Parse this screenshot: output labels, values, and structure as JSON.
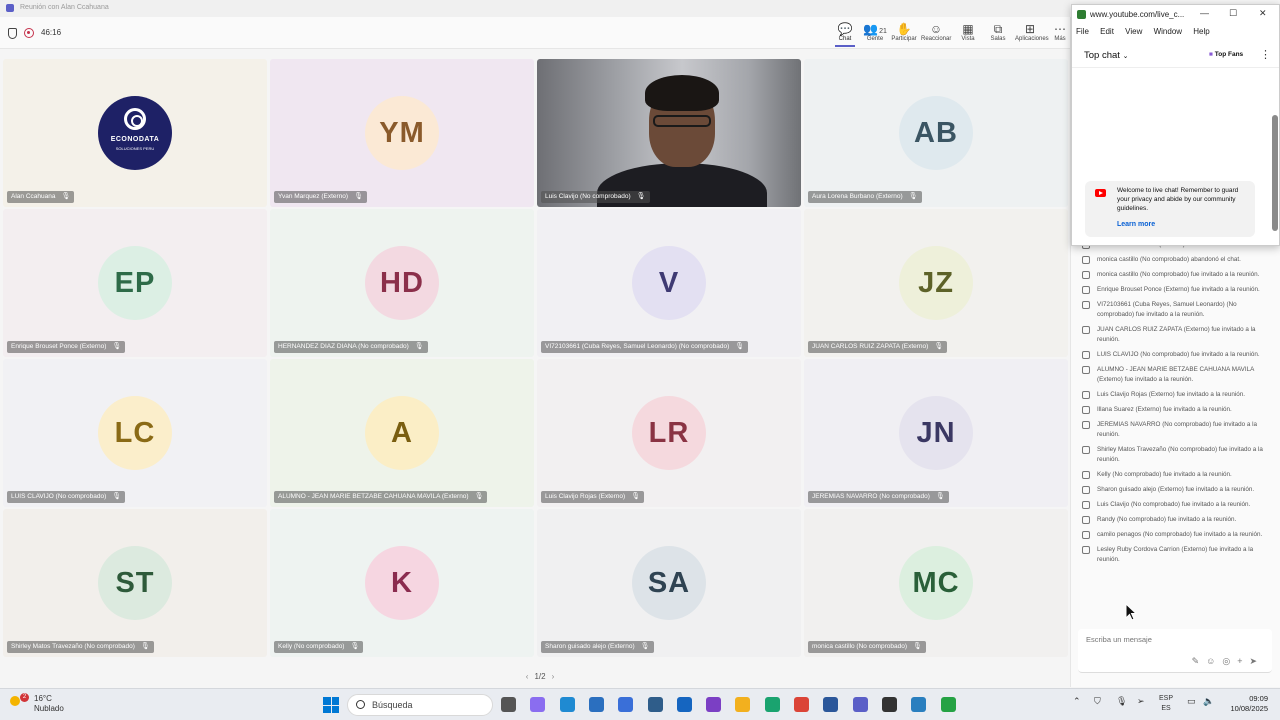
{
  "window": {
    "title": "Reunión con Alan Ccahuana"
  },
  "meeting": {
    "timer": "46:16",
    "toolbar": [
      {
        "label": "Chat",
        "icon": "chat-icon",
        "glyph": "💬",
        "active": true
      },
      {
        "label": "Gente",
        "icon": "people-icon",
        "glyph": "👥",
        "count": "21"
      },
      {
        "label": "Participar",
        "icon": "hand-icon",
        "glyph": "✋"
      },
      {
        "label": "Reaccionar",
        "icon": "emoji-icon",
        "glyph": "☺"
      },
      {
        "label": "Vista",
        "icon": "grid-view-icon",
        "glyph": "▦"
      },
      {
        "label": "Salas",
        "icon": "rooms-icon",
        "glyph": "⧉"
      },
      {
        "label": "Aplicaciones",
        "icon": "add-apps-icon",
        "glyph": "⊞"
      },
      {
        "label": "Más",
        "icon": "more-icon",
        "glyph": "⋯"
      }
    ]
  },
  "participants": [
    {
      "initials": "",
      "name": "Alan Ccahuana",
      "type": "logo",
      "bg": "#f4f1e9",
      "avatar_bg": "#1e2166",
      "avatar_fg": "#ffffff",
      "logo_line1": "ECONODATA",
      "logo_line2": "SOLUCIONES PERU"
    },
    {
      "initials": "YM",
      "name": "Yvan Marquez (Externo)",
      "bg": "#f0e7f1",
      "avatar_bg": "#fbe9d5",
      "avatar_fg": "#8a5a2b"
    },
    {
      "initials": "",
      "name": "Luis Clavijo (No comprobado)",
      "type": "video",
      "bg": "#8d8f94"
    },
    {
      "initials": "AB",
      "name": "Aura Lorena Burbano (Externo)",
      "bg": "#eef1f2",
      "avatar_bg": "#dfe9ee",
      "avatar_fg": "#3b5563"
    },
    {
      "initials": "EP",
      "name": "Enrique Brouset Ponce (Externo)",
      "bg": "#f3eef0",
      "avatar_bg": "#dcefe4",
      "avatar_fg": "#2e6b48"
    },
    {
      "initials": "HD",
      "name": "HERNANDEZ DIAZ DIANA (No comprobado)",
      "bg": "#eef3ef",
      "avatar_bg": "#f3d9e1",
      "avatar_fg": "#8b2f4a"
    },
    {
      "initials": "V",
      "name": "VI72103661 (Cuba Reyes, Samuel Leonardo) (No comprobado)",
      "bg": "#f1f0f3",
      "avatar_bg": "#e3e0f2",
      "avatar_fg": "#3f3a73"
    },
    {
      "initials": "JZ",
      "name": "JUAN CARLOS RUIZ ZAPATA (Externo)",
      "bg": "#f2f1ee",
      "avatar_bg": "#eef0da",
      "avatar_fg": "#5d6228"
    },
    {
      "initials": "LC",
      "name": "LUIS CLAVIJO (No comprobado)",
      "bg": "#f1f1f4",
      "avatar_bg": "#fbeecb",
      "avatar_fg": "#8a6a16"
    },
    {
      "initials": "A",
      "name": "ALUMNO - JEAN MARIE BETZABE CAHUANA MAVILA (Externo)",
      "bg": "#eef3ea",
      "avatar_bg": "#fbeec6",
      "avatar_fg": "#7a5e10"
    },
    {
      "initials": "LR",
      "name": "Luis Clavijo Rojas (Externo)",
      "bg": "#f2f0f1",
      "avatar_bg": "#f5d9de",
      "avatar_fg": "#8a3343"
    },
    {
      "initials": "JN",
      "name": "JEREMIAS NAVARRO (No comprobado)",
      "bg": "#f0eff3",
      "avatar_bg": "#e5e3ee",
      "avatar_fg": "#3b3863"
    },
    {
      "initials": "ST",
      "name": "Shirley Matos Travezaño (No comprobado)",
      "bg": "#f2efeb",
      "avatar_bg": "#dceadf",
      "avatar_fg": "#2e5a3a"
    },
    {
      "initials": "K",
      "name": "Kelly (No comprobado)",
      "bg": "#eef3f1",
      "avatar_bg": "#f6d6e1",
      "avatar_fg": "#8b2c4f"
    },
    {
      "initials": "SA",
      "name": "Sharon guisado alejo (Externo)",
      "bg": "#f0f0f1",
      "avatar_bg": "#dde3e8",
      "avatar_fg": "#2f4352"
    },
    {
      "initials": "MC",
      "name": "monica castillo (No comprobado)",
      "bg": "#f1f0ef",
      "avatar_bg": "#dcefdf",
      "avatar_fg": "#2a6039"
    }
  ],
  "pager": {
    "label": "1/2"
  },
  "youtube": {
    "window_title": "www.youtube.com/live_c...",
    "menu": [
      "File",
      "Edit",
      "View",
      "Window",
      "Help"
    ],
    "top_chat": "Top chat",
    "top_fans": "Top Fans",
    "welcome": "Welcome to live chat! Remember to guard your privacy and abide by our community guidelines.",
    "learn_more": "Learn more"
  },
  "chat_events": [
    "Aura Lorena Burbano (Externo) fue invitado a la reunión.",
    "monica castillo (No comprobado) abandonó el chat.",
    "monica castillo (No comprobado) fue invitado a la reunión.",
    "Enrique Brouset Ponce (Externo) fue invitado a la reunión.",
    "VI72103661 (Cuba Reyes, Samuel Leonardo) (No comprobado) fue invitado a la reunión.",
    "JUAN CARLOS RUIZ ZAPATA (Externo) fue invitado a la reunión.",
    "LUIS CLAVIJO (No comprobado) fue invitado a la reunión.",
    "ALUMNO - JEAN MARIE BETZABE CAHUANA MAVILA (Externo) fue invitado a la reunión.",
    "Luis Clavijo Rojas (Externo) fue invitado a la reunión.",
    "Illana Suarez (Externo) fue invitado a la reunión.",
    "JEREMIAS NAVARRO (No comprobado) fue invitado a la reunión.",
    "Shirley Matos Travezaño (No comprobado) fue invitado a la reunión.",
    "Kelly (No comprobado) fue invitado a la reunión.",
    "Sharon guisado alejo (Externo) fue invitado a la reunión.",
    "Luis Clavijo (No comprobado) fue invitado a la reunión.",
    "Randy (No comprobado) fue invitado a la reunión.",
    "camilo penagos (No comprobado) fue invitado a la reunión.",
    "Lesley Ruby Cordova Carrion (Externo) fue invitado a la reunión."
  ],
  "compose": {
    "placeholder": "Escriba un mensaje"
  },
  "taskbar": {
    "weather_temp": "16°C",
    "weather_desc": "Nublado",
    "weather_badge": "2",
    "search_label": "Búsqueda",
    "lang_top": "ESP",
    "lang_bottom": "ES",
    "time": "09:09",
    "date": "10/08/2025",
    "apps": [
      {
        "name": "task-view-icon",
        "color": "#555555"
      },
      {
        "name": "copilot-icon",
        "color": "#8a6df0"
      },
      {
        "name": "vscode-icon",
        "color": "#1f8ad2"
      },
      {
        "name": "store-icon",
        "color": "#2b6fbf"
      },
      {
        "name": "text-app-icon",
        "color": "#3a6fd8"
      },
      {
        "name": "network-app-icon",
        "color": "#2f5d8a"
      },
      {
        "name": "snip-icon",
        "color": "#1565c0"
      },
      {
        "name": "vs-icon",
        "color": "#7b3fc4"
      },
      {
        "name": "folder-icon",
        "color": "#f2b01e"
      },
      {
        "name": "edge-icon",
        "color": "#1aa36f"
      },
      {
        "name": "chrome-icon",
        "color": "#db4437"
      },
      {
        "name": "word-icon",
        "color": "#2b579a"
      },
      {
        "name": "teams-icon",
        "color": "#5b5fc7"
      },
      {
        "name": "obs-icon",
        "color": "#333333"
      },
      {
        "name": "notepad-icon",
        "color": "#2a7fbf"
      },
      {
        "name": "whatsapp-icon",
        "color": "#25a244"
      }
    ]
  }
}
